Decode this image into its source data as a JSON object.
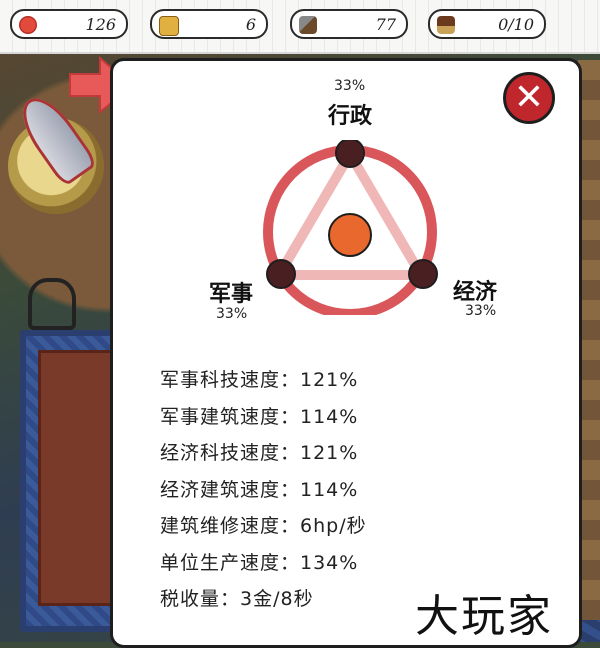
{
  "resources": {
    "food": {
      "icon": "tomato-icon",
      "value": "126"
    },
    "gold": {
      "icon": "gold-ore-icon",
      "value": "6"
    },
    "wood": {
      "icon": "axe-icon",
      "value": "77"
    },
    "population": {
      "icon": "house-icon",
      "value": "0/10"
    }
  },
  "policy": {
    "administration": {
      "label": "行政",
      "percent": "33%"
    },
    "military": {
      "label": "军事",
      "percent": "33%"
    },
    "economy": {
      "label": "经济",
      "percent": "33%"
    }
  },
  "stats": [
    "军事科技速度：121%",
    "军事建筑速度：114%",
    "经济科技速度：121%",
    "经济建筑速度：114%",
    "建筑维修速度：6hp/秒",
    "单位生产速度：134%",
    "税收量：3金/8秒"
  ],
  "watermark": "大玩家",
  "colors": {
    "accent_red": "#c0272d",
    "ring_red": "#d9565a",
    "node_dark": "#4a1f22",
    "center_orange": "#e8682e"
  }
}
